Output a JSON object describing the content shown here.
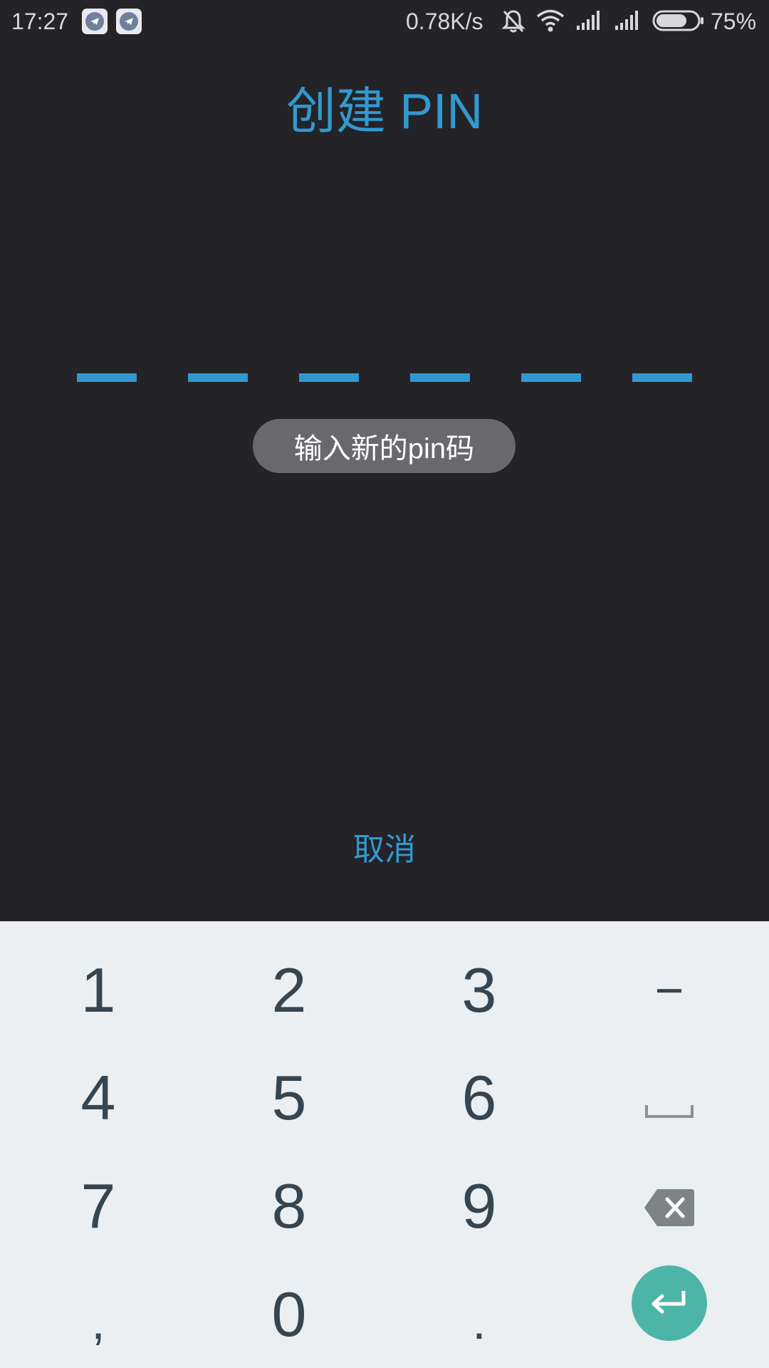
{
  "status_bar": {
    "time": "17:27",
    "net_speed": "0.78K/s",
    "battery_percent": "75%",
    "battery_level": 0.75,
    "icons": [
      "telegram-icon",
      "telegram-icon",
      "bell-muted-icon",
      "wifi-icon",
      "signal-icon",
      "signal-icon",
      "battery-icon"
    ]
  },
  "screen": {
    "title": "创建 PIN",
    "pin_length": 6,
    "toast": "输入新的pin码",
    "cancel_label": "取消",
    "accent_color": "#3299cf",
    "background_color": "#232328"
  },
  "keypad": {
    "rows": [
      [
        "1",
        "2",
        "3",
        "−"
      ],
      [
        "4",
        "5",
        "6",
        "␣"
      ],
      [
        "7",
        "8",
        "9",
        "backspace"
      ],
      [
        ",",
        "0",
        ".",
        "enter"
      ]
    ],
    "special_keys": {
      "minus": "−",
      "comma": ",",
      "period": "."
    },
    "space_icon": "space-icon",
    "backspace_icon": "backspace-icon",
    "enter_icon": "enter-icon",
    "enter_color": "#4db5a8"
  }
}
